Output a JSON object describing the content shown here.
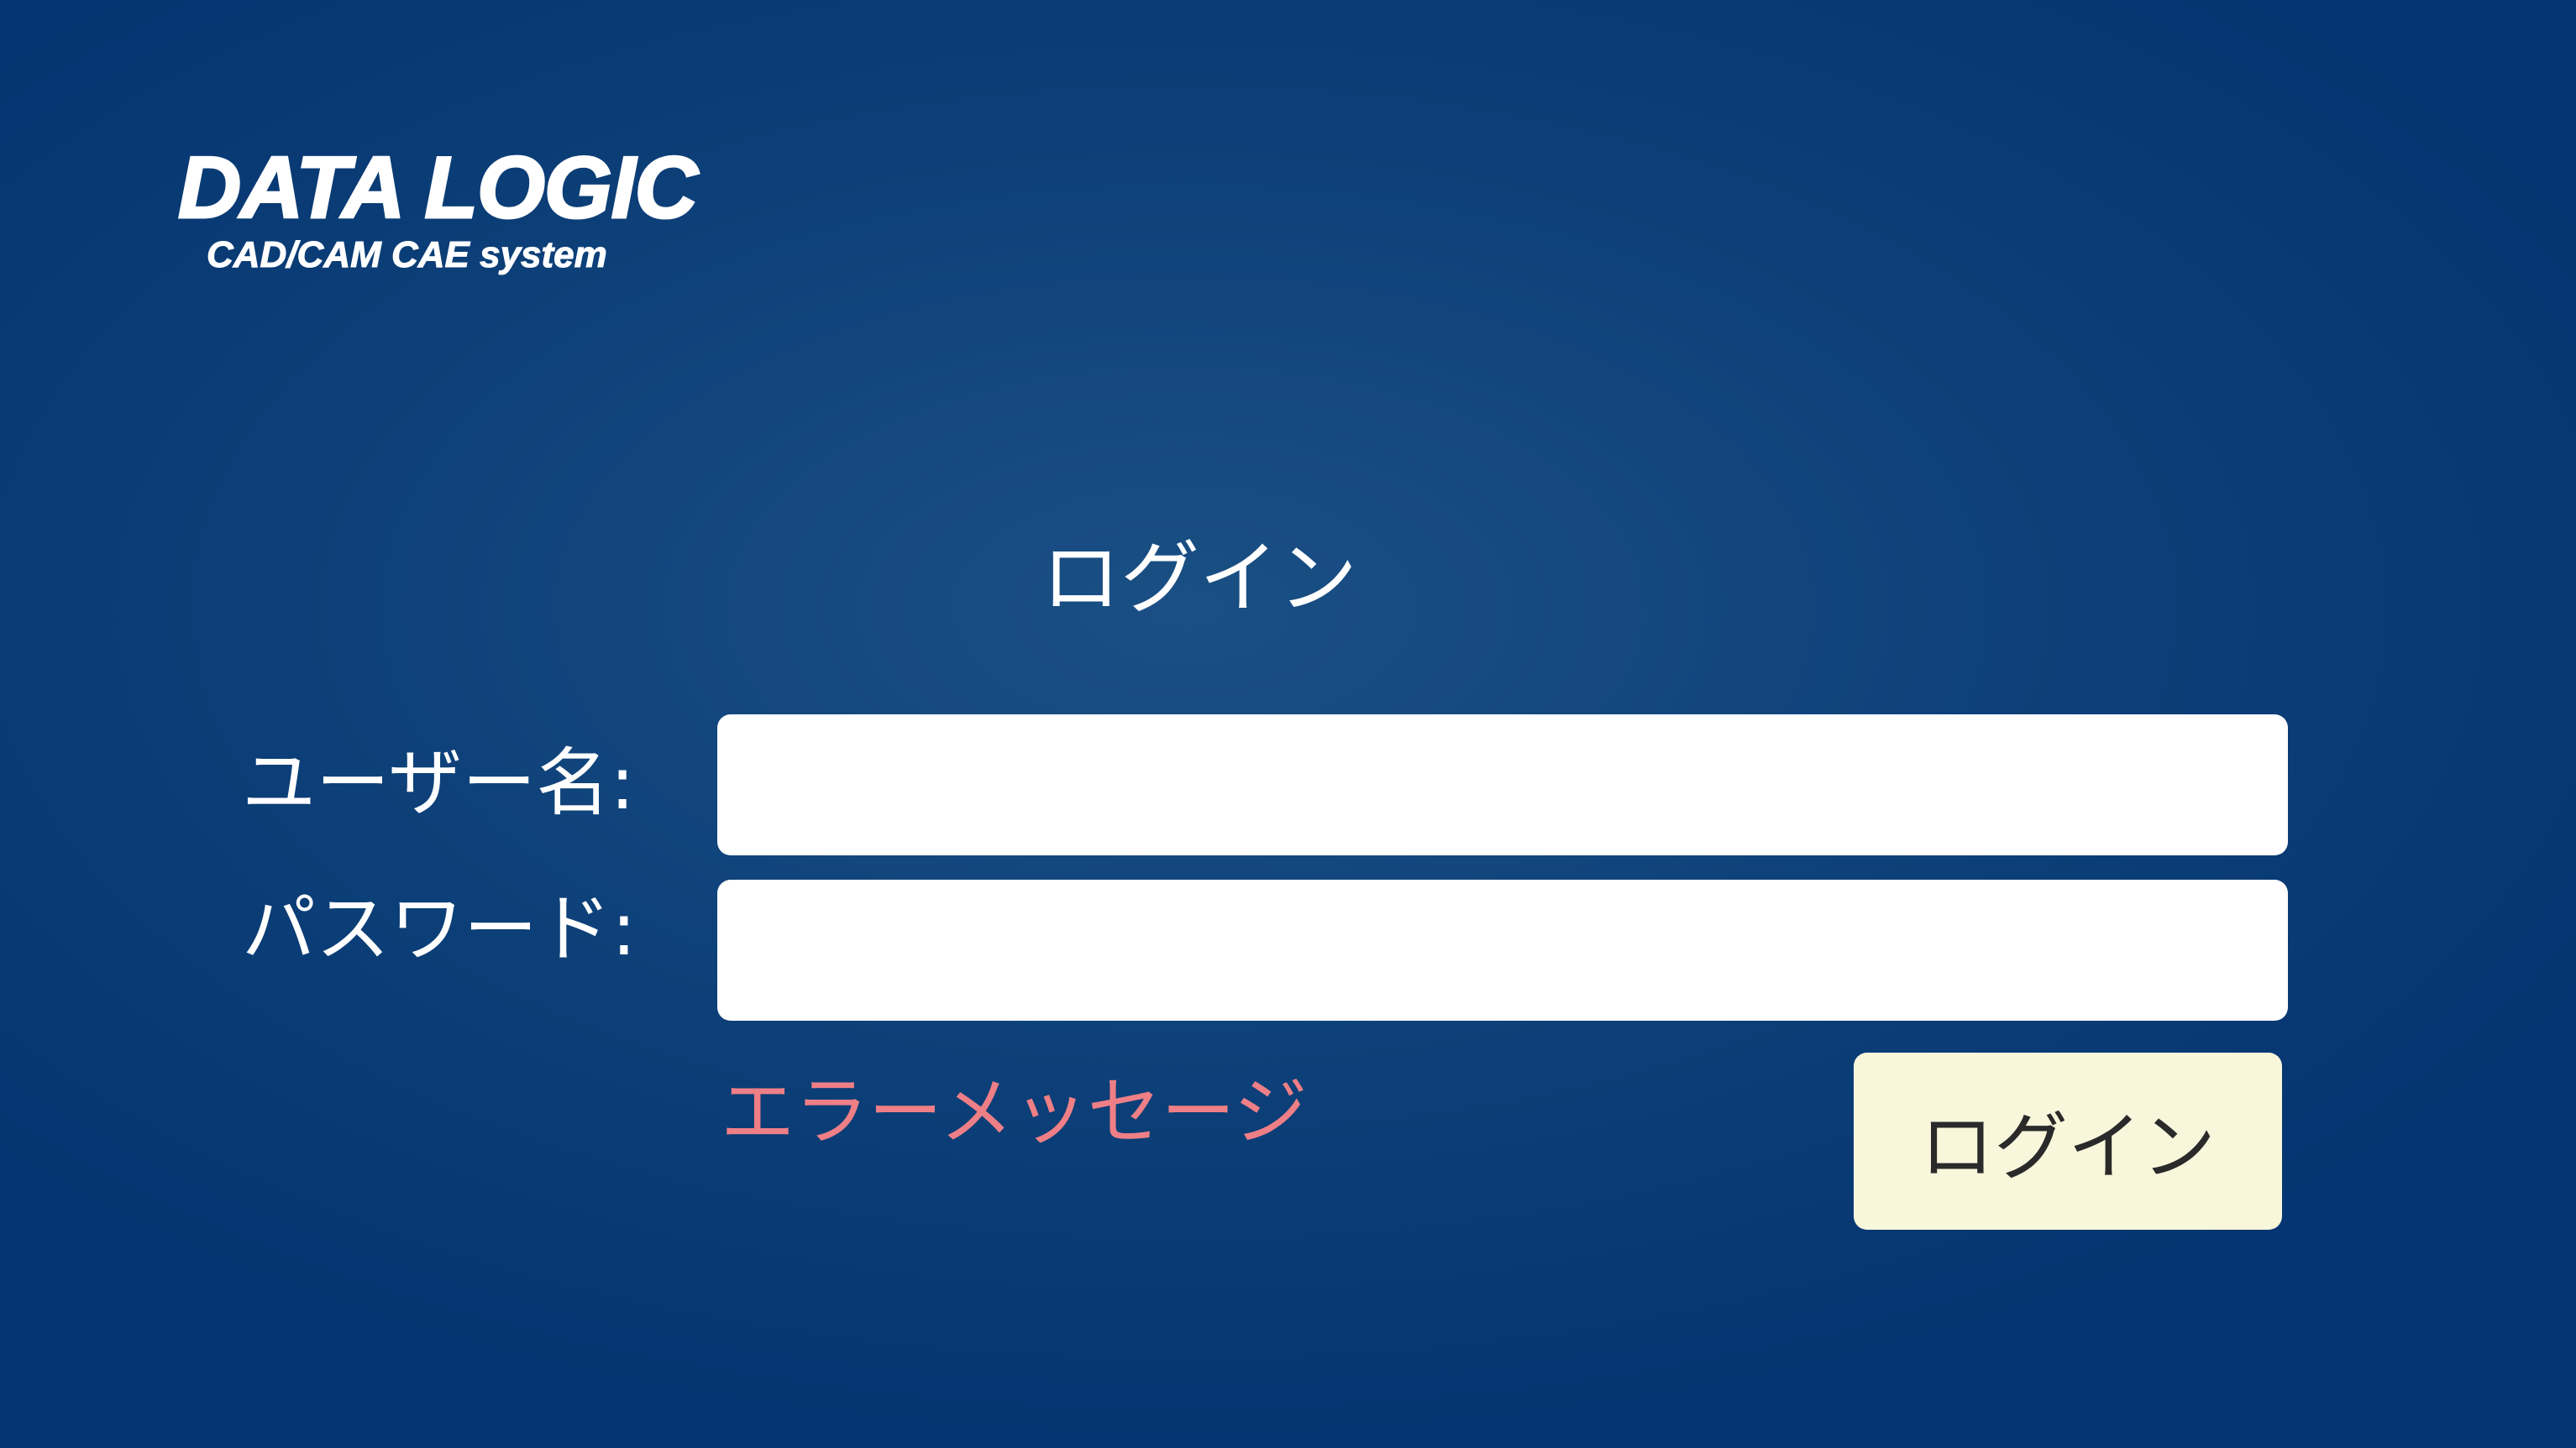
{
  "logo": {
    "title": "DATA LOGIC",
    "subtitle": "CAD/CAM CAE system"
  },
  "page": {
    "title": "ログイン"
  },
  "form": {
    "username_label": "ユーザー名:",
    "username_value": "",
    "password_label": "パスワード:",
    "password_value": "",
    "error_message": "エラーメッセージ",
    "login_button_label": "ログイン"
  },
  "colors": {
    "background": "#0b3d76",
    "input_background": "#ffffff",
    "error_text": "#ee7f86",
    "button_background": "#f8f7dc",
    "button_text": "#2a2a2a"
  }
}
